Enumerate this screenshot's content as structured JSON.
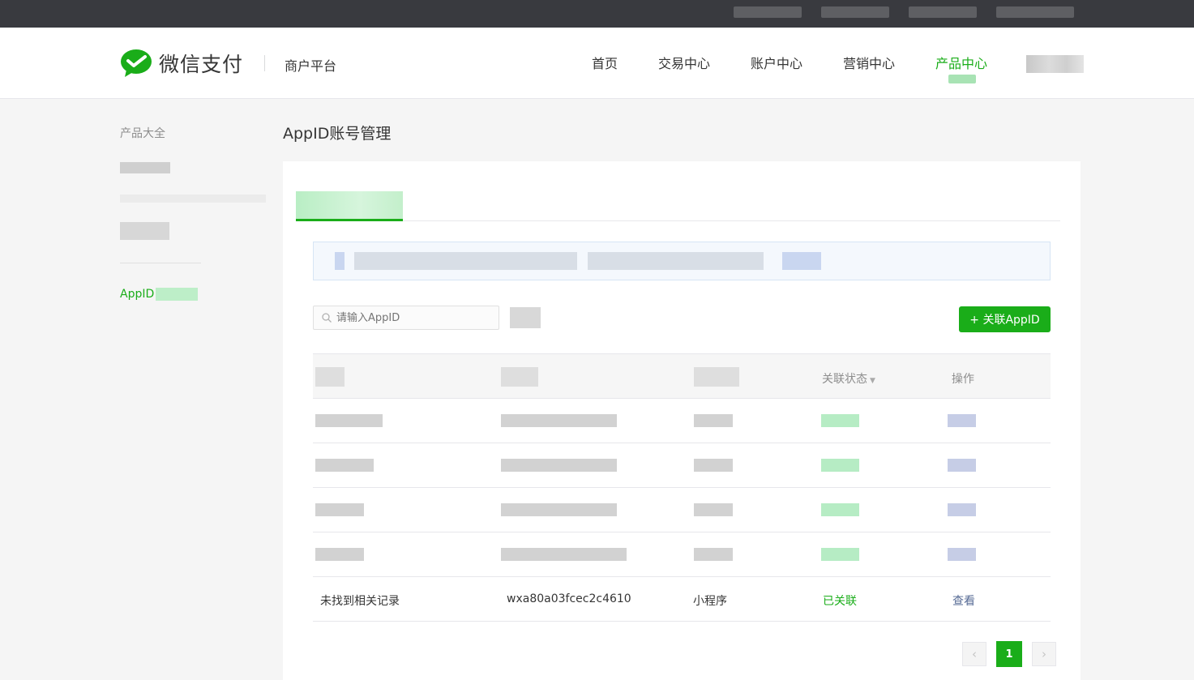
{
  "header": {
    "brand": "微信支付",
    "platform": "商户平台",
    "nav": [
      {
        "label": "首页"
      },
      {
        "label": "交易中心"
      },
      {
        "label": "账户中心"
      },
      {
        "label": "营销中心"
      },
      {
        "label": "产品中心"
      }
    ],
    "active_nav": "产品中心"
  },
  "sidebar": {
    "items": [
      {
        "label": "产品大全"
      },
      {
        "label": "AppID"
      }
    ]
  },
  "main": {
    "title": "AppID账号管理",
    "search": {
      "placeholder": "请输入AppID"
    },
    "add_button": "+ 关联AppID",
    "table": {
      "headers": {
        "status": "关联状态",
        "action": "操作"
      },
      "rows": [
        {
          "name": "未找到相关记录",
          "appid": "wxa80a03fcec2c4610",
          "type": "小程序",
          "status": "已关联",
          "action": "查看"
        }
      ]
    },
    "pagination": {
      "current": "1",
      "prev": "‹",
      "next": "›"
    }
  },
  "colors": {
    "brand_green": "#1aad19",
    "link_blue": "#576b95",
    "topbar": "#393a3f"
  }
}
